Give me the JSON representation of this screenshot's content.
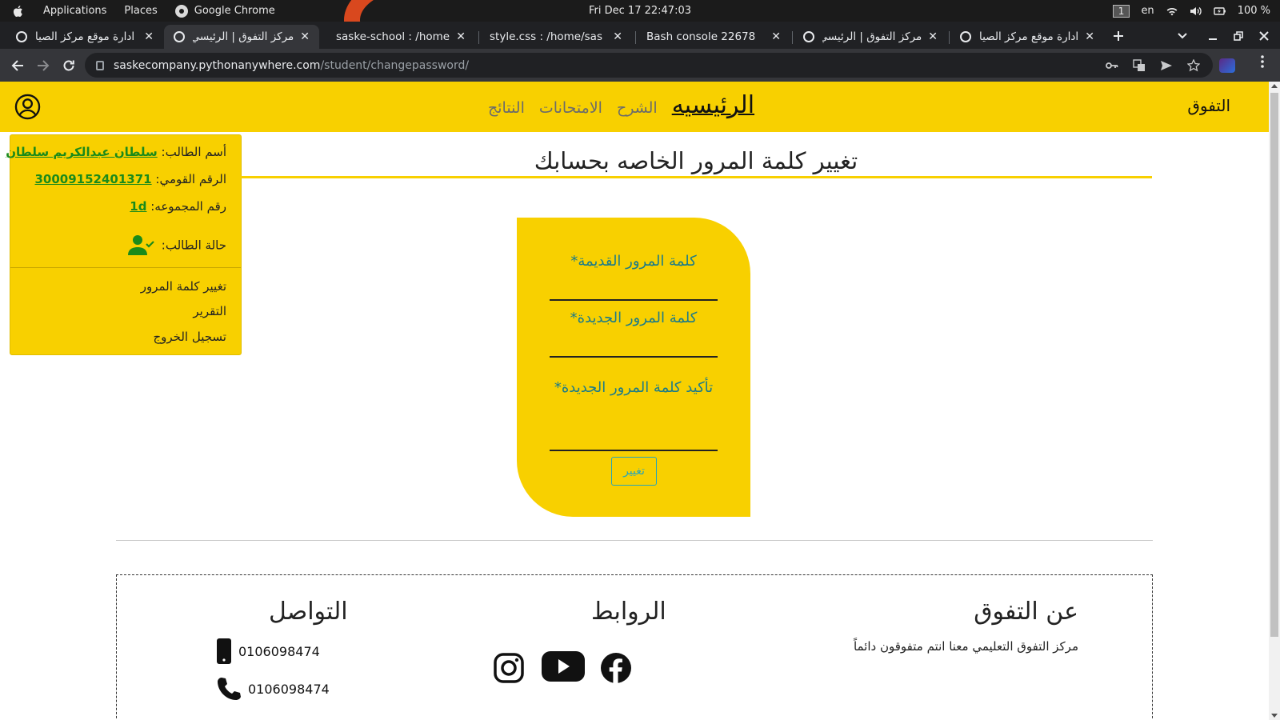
{
  "system_bar": {
    "applications": "Applications",
    "places": "Places",
    "browser_name": "Google Chrome",
    "datetime": "Fri Dec 17  22:47:03",
    "workspace": "1",
    "language": "en",
    "battery": "100 %"
  },
  "tabs": [
    {
      "title": "ادارة موقع مركز الصيا",
      "active": false
    },
    {
      "title": "مركز التفوق | الرئيسي",
      "active": true
    },
    {
      "title": "saske-school : /home",
      "active": false
    },
    {
      "title": "style.css : /home/sas",
      "active": false
    },
    {
      "title": "Bash console 22678",
      "active": false
    },
    {
      "title": "مركز التفوق | الرئيسي",
      "active": false
    },
    {
      "title": "ادارة موقع مركز الصيا",
      "active": false
    }
  ],
  "address_bar": {
    "host": "saskecompany.pythonanywhere.com",
    "path": "/student/changepassword/"
  },
  "site_nav": {
    "brand": "التفوق",
    "links": [
      "الرئيسيه",
      "الشرح",
      "الامتحانات",
      "النتائج"
    ]
  },
  "student_card": {
    "name_label": "أسم الطالب:",
    "name_value": "سلطان عبدالكريم سلطان",
    "national_id_label": "الرقم القومي:",
    "national_id_value": "30009152401371",
    "group_label": "رقم المجموعه:",
    "group_value": "1d",
    "status_label": "حالة الطالب:",
    "menu": [
      "تغيير كلمة المرور",
      "التقرير",
      "تسجيل الخروج"
    ]
  },
  "page": {
    "title": "تغيير كلمة المرور الخاصه بحسابك"
  },
  "form": {
    "old_password_label": "كلمة المرور القديمة*",
    "new_password_label": "كلمة المرور الجديدة*",
    "confirm_password_label": "تأكيد كلمة المرور الجديدة*",
    "submit_label": "تغيير"
  },
  "footer": {
    "about_heading": "عن التفوق",
    "about_text": "مركز التفوق التعليمي معنا انتم متفوقون دائماً",
    "links_heading": "الروابط",
    "contact_heading": "التواصل",
    "mobile": "0106098474",
    "phone": "0106098474",
    "social_icons": [
      "facebook-icon",
      "youtube-icon",
      "instagram-icon"
    ]
  },
  "colors": {
    "brand_yellow": "#f8d000",
    "link_green": "#1a8a1a",
    "teal": "#27a5b8"
  }
}
